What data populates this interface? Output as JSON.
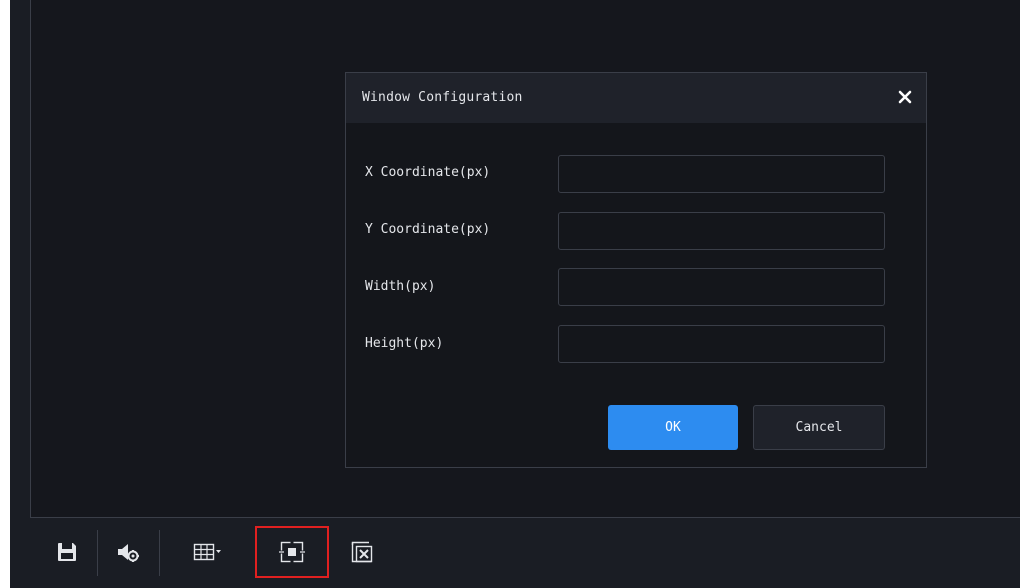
{
  "dialog": {
    "title": "Window Configuration",
    "fields": [
      {
        "label": "X Coordinate(px)",
        "value": ""
      },
      {
        "label": "Y Coordinate(px)",
        "value": ""
      },
      {
        "label": "Width(px)",
        "value": ""
      },
      {
        "label": "Height(px)",
        "value": ""
      }
    ],
    "ok_label": "OK",
    "cancel_label": "Cancel"
  },
  "toolbar": {
    "items": [
      {
        "name": "save-icon"
      },
      {
        "name": "audio-settings-icon"
      },
      {
        "name": "grid-layout-icon"
      },
      {
        "name": "window-config-icon",
        "selected": true
      },
      {
        "name": "close-window-icon"
      }
    ]
  },
  "colors": {
    "background": "#15171d",
    "dialog_header": "#1f222a",
    "accent": "#2d8cf0",
    "highlight": "#e02020"
  }
}
